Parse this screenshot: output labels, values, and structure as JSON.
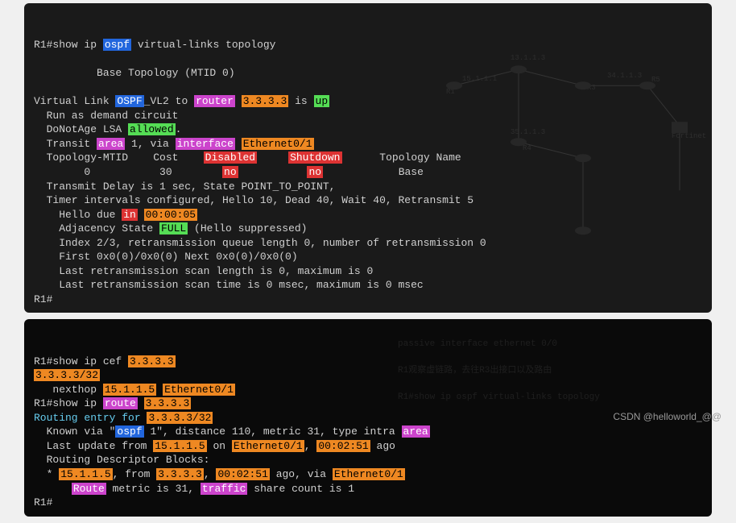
{
  "watermark": "CSDN @helloworld_@@",
  "block1": {
    "prompt": "R1#",
    "cmd_pre": "show ip ",
    "cmd_ospf": "ospf",
    "cmd_post": " virtual-links topology",
    "base_topo": "          Base Topology (MTID 0)",
    "vl_pre": "Virtual Link ",
    "vl_ospf": "OSPF",
    "vl_mid1": "_VL2 to ",
    "vl_router": "router",
    "vl_sp": " ",
    "vl_addr": "3.3.3.3",
    "vl_is": " is ",
    "vl_up": "up",
    "run_demand": "  Run as demand circuit",
    "dna_pre": "  DoNotAge LSA ",
    "dna_allowed": "allowed",
    "dna_dot": ".",
    "transit_pre": "  Transit ",
    "transit_area": "area",
    "transit_mid": " 1, via ",
    "transit_iface": "interface",
    "transit_sp": " ",
    "transit_eth": "Ethernet0/1",
    "hdr_pre": "  Topology-MTID    Cost    ",
    "hdr_disabled": "Disabled",
    "hdr_sp": "     ",
    "hdr_shutdown": "Shutdown",
    "hdr_post": "      Topology Name",
    "row_pre": "        0           30        ",
    "row_no1": "no",
    "row_sp": "           ",
    "row_no2": "no",
    "row_post": "            Base",
    "tx_delay": "  Transmit Delay is 1 sec, State POINT_TO_POINT,",
    "timers": "  Timer intervals configured, Hello 10, Dead 40, Wait 40, Retransmit 5",
    "hello_pre": "    Hello due ",
    "hello_in": "in",
    "hello_sp": " ",
    "hello_time": "00:00:05",
    "adj_pre": "    Adjacency State ",
    "adj_full": "FULL",
    "adj_post": " (Hello suppressed)",
    "idx": "    Index 2/3, retransmission queue length 0, number of retransmission 0",
    "first": "    First 0x0(0)/0x0(0) Next 0x0(0)/0x0(0)",
    "scanlen": "    Last retransmission scan length is 0, maximum is 0",
    "scantime": "    Last retransmission scan time is 0 msec, maximum is 0 msec",
    "end_prompt": "R1#",
    "topo_labels": {
      "l1": "15.1.1.1",
      "l2": "13.1.1.3",
      "l3": "34.1.1.3",
      "l4": "35.1.1.3",
      "r1": "R1",
      "r3": "R3",
      "r4": "R4",
      "r5": "R5",
      "fn": "Fortinet"
    }
  },
  "block2": {
    "prompt1": "R1#",
    "cef_cmd": "show ip cef ",
    "cef_addr": "3.3.3.3",
    "prefix1": "3.3.3.3/32",
    "nh_pre": "   nexthop ",
    "nh_ip": "15.1.1.5",
    "nh_sp": " ",
    "nh_eth": "Ethernet0/1",
    "prompt2": "R1#",
    "route_pre": "show ip ",
    "route_kw": "route",
    "route_sp": " ",
    "route_addr": "3.3.3.3",
    "entry_pre": "Routing entry for ",
    "entry_prefix": "3.3.3.3/32",
    "known_pre": "  Known via \"",
    "known_ospf": "ospf",
    "known_post": " 1\", distance 110, metric 31, type intra ",
    "known_area": "area",
    "last_pre": "  Last update from ",
    "last_ip": "15.1.1.5",
    "last_on": " on ",
    "last_eth": "Ethernet0/1",
    "last_comma": ", ",
    "last_time": "00:02:51",
    "last_ago": " ago",
    "rdb": "  Routing Descriptor Blocks:",
    "star_pre": "  * ",
    "star_ip": "15.1.1.5",
    "star_from": ", from ",
    "star_addr": "3.3.3.3",
    "star_comma": ", ",
    "star_time": "00:02:51",
    "star_ago_via": " ago, via ",
    "star_eth": "Ethernet0/1",
    "metric_sp": "      ",
    "metric_route": "Route",
    "metric_mid": " metric is 31, ",
    "metric_traffic": "traffic",
    "metric_post": " share count is 1",
    "end_prompt": "R1#",
    "faint_text1": "passive interface ethernet 0/0",
    "faint_text2": "R1观察虚链路，去往R3出接口以及路由",
    "faint_text3": "R1#show ip ospf virtual-links topology"
  }
}
